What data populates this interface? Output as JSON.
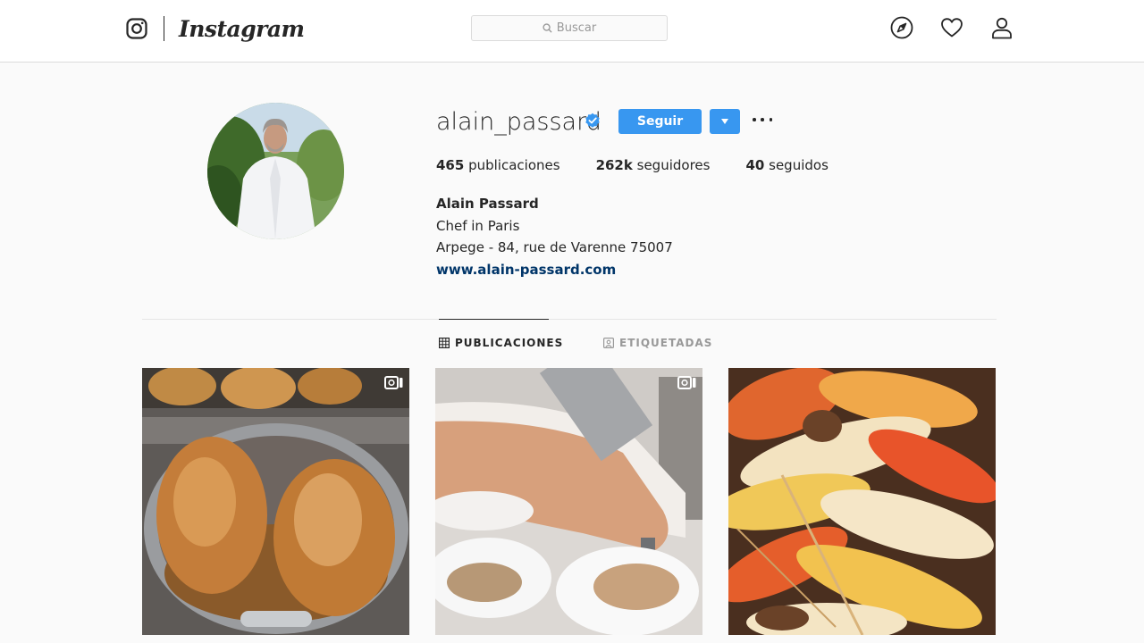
{
  "nav": {
    "brand": "Instagram",
    "search_placeholder": "Buscar",
    "icons": [
      "explore-icon",
      "heart-icon",
      "profile-icon"
    ]
  },
  "profile": {
    "username": "alain_passard",
    "verified": true,
    "follow_label": "Seguir",
    "stats": {
      "posts_count": "465",
      "posts_label": "publicaciones",
      "followers_count": "262k",
      "followers_label": "seguidores",
      "following_count": "40",
      "following_label": "seguidos"
    },
    "bio": {
      "name": "Alain Passard",
      "line1": "Chef in Paris",
      "line2": "Arpege - 84, rue de Varenne 75007",
      "link": "www.alain-passard.com"
    }
  },
  "tabs": [
    {
      "label": "PUBLICACIONES",
      "active": true
    },
    {
      "label": "ETIQUETADAS",
      "active": false
    }
  ],
  "posts": [
    {
      "subject": "roast-chickens-in-pan",
      "is_video": true
    },
    {
      "subject": "chef-pouring-sauce",
      "is_video": true
    },
    {
      "subject": "grilled-langoustines",
      "is_video": false
    }
  ],
  "colors": {
    "accent": "#3897f0",
    "link": "#003569",
    "verified": "#3897f0"
  }
}
